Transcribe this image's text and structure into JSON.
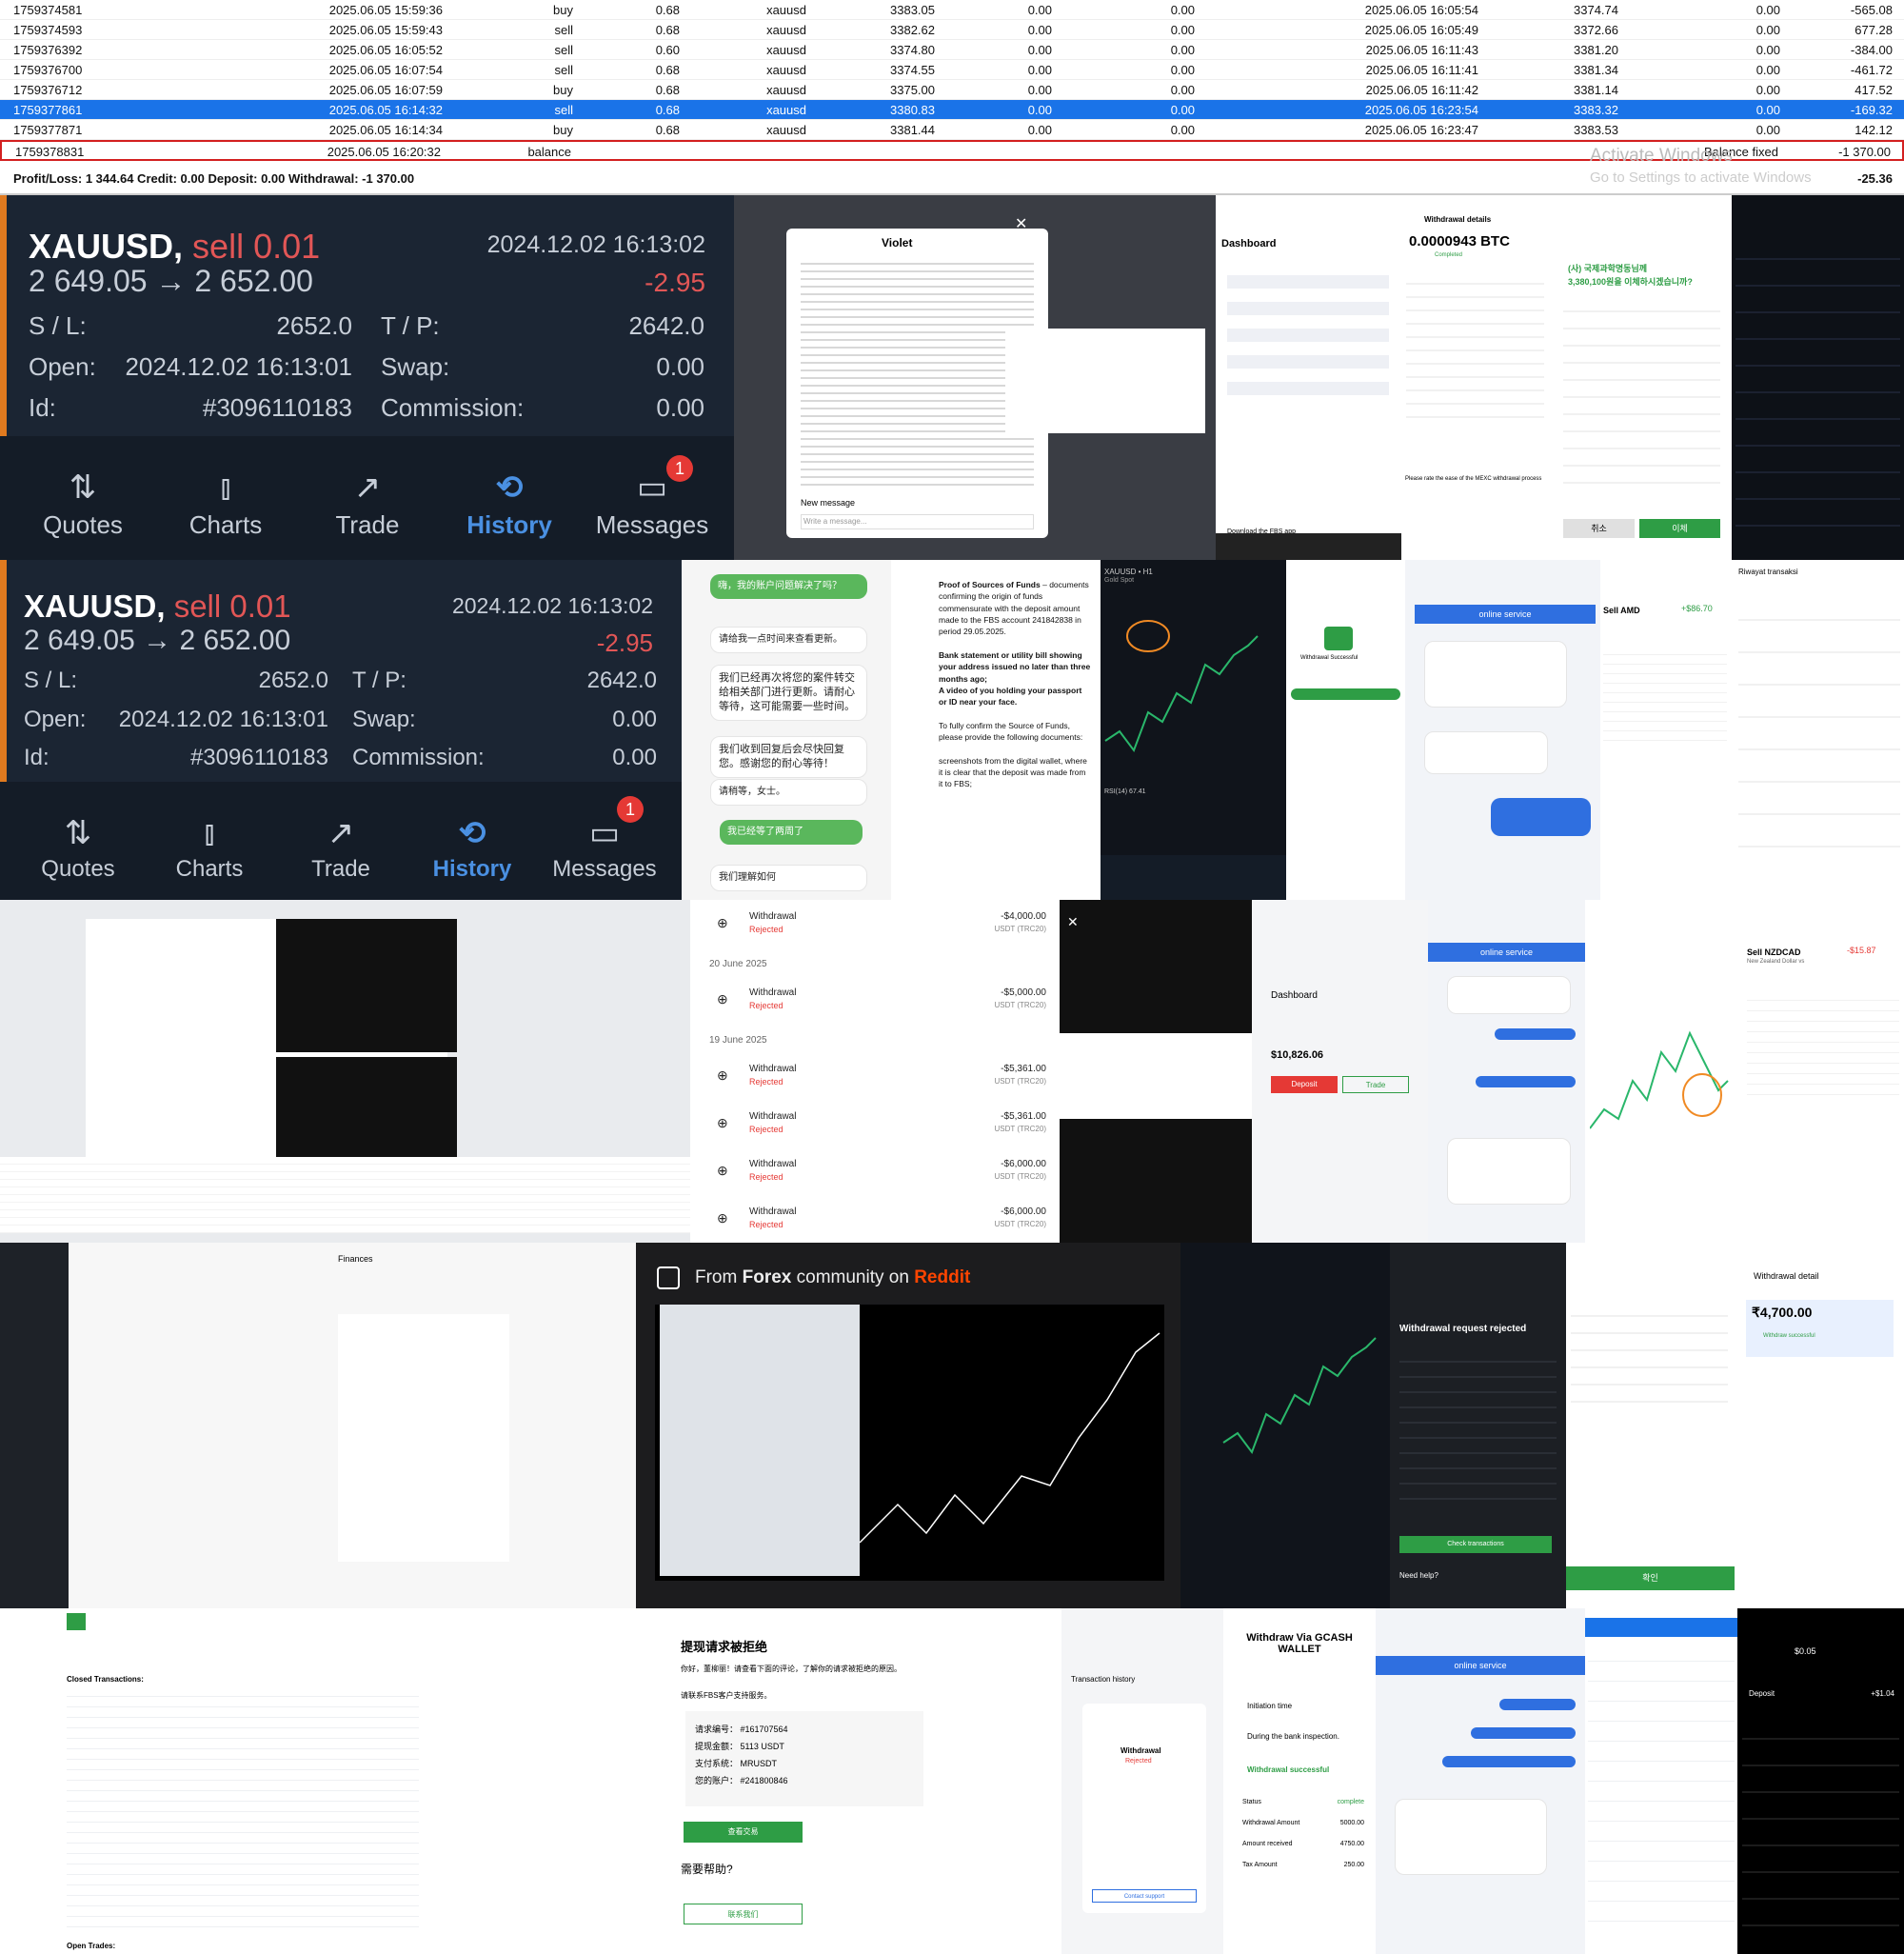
{
  "trade_table": {
    "rows": [
      {
        "id": "1759374581",
        "open_time": "2025.06.05 15:59:36",
        "type": "buy",
        "volume": "0.68",
        "symbol": "xauusd",
        "open_price": "3383.05",
        "sl": "0.00",
        "tp": "0.00",
        "close_time": "2025.06.05 16:05:54",
        "close_price": "3374.74",
        "swap": "0.00",
        "profit": "-565.08"
      },
      {
        "id": "1759374593",
        "open_time": "2025.06.05 15:59:43",
        "type": "sell",
        "volume": "0.68",
        "symbol": "xauusd",
        "open_price": "3382.62",
        "sl": "0.00",
        "tp": "0.00",
        "close_time": "2025.06.05 16:05:49",
        "close_price": "3372.66",
        "swap": "0.00",
        "profit": "677.28"
      },
      {
        "id": "1759376392",
        "open_time": "2025.06.05 16:05:52",
        "type": "sell",
        "volume": "0.60",
        "symbol": "xauusd",
        "open_price": "3374.80",
        "sl": "0.00",
        "tp": "0.00",
        "close_time": "2025.06.05 16:11:43",
        "close_price": "3381.20",
        "swap": "0.00",
        "profit": "-384.00"
      },
      {
        "id": "1759376700",
        "open_time": "2025.06.05 16:07:54",
        "type": "sell",
        "volume": "0.68",
        "symbol": "xauusd",
        "open_price": "3374.55",
        "sl": "0.00",
        "tp": "0.00",
        "close_time": "2025.06.05 16:11:41",
        "close_price": "3381.34",
        "swap": "0.00",
        "profit": "-461.72"
      },
      {
        "id": "1759376712",
        "open_time": "2025.06.05 16:07:59",
        "type": "buy",
        "volume": "0.68",
        "symbol": "xauusd",
        "open_price": "3375.00",
        "sl": "0.00",
        "tp": "0.00",
        "close_time": "2025.06.05 16:11:42",
        "close_price": "3381.14",
        "swap": "0.00",
        "profit": "417.52"
      },
      {
        "id": "1759377861",
        "open_time": "2025.06.05 16:14:32",
        "type": "sell",
        "volume": "0.68",
        "symbol": "xauusd",
        "open_price": "3380.83",
        "sl": "0.00",
        "tp": "0.00",
        "close_time": "2025.06.05 16:23:54",
        "close_price": "3383.32",
        "swap": "0.00",
        "profit": "-169.32"
      },
      {
        "id": "1759377871",
        "open_time": "2025.06.05 16:14:34",
        "type": "buy",
        "volume": "0.68",
        "symbol": "xauusd",
        "open_price": "3381.44",
        "sl": "0.00",
        "tp": "0.00",
        "close_time": "2025.06.05 16:23:47",
        "close_price": "3383.53",
        "swap": "0.00",
        "profit": "142.12"
      }
    ],
    "balance_row": {
      "id": "1759378831",
      "time": "2025.06.05 16:20:32",
      "type": "balance",
      "comment": "Balance fixed",
      "profit": "-1 370.00"
    },
    "summary": "Profit/Loss: 1 344.64  Credit: 0.00  Deposit: 0.00  Withdrawal: -1 370.00",
    "summary_total": "-25.36",
    "watermark_1": "Activate Windows",
    "watermark_2": "Go to Settings to activate Windows"
  },
  "trade_card_1": {
    "symbol": "XAUUSD,",
    "side": "sell 0.01",
    "datetime": "2024.12.02 16:13:02",
    "price_move": "2 649.05 → 2 652.00",
    "profit": "-2.95",
    "sl_label": "S / L:",
    "sl_value": "2652.0",
    "tp_label": "T / P:",
    "tp_value": "2642.0",
    "open_label": "Open:",
    "open_value": "2024.12.02 16:13:01",
    "swap_label": "Swap:",
    "swap_value": "0.00",
    "id_label": "Id:",
    "id_value": "#3096110183",
    "commission_label": "Commission:",
    "commission_value": "0.00"
  },
  "trade_card_2": {
    "symbol": "XAUUSD,",
    "side": "sell 0.01",
    "datetime": "2024.12.02 16:13:02",
    "price_move": "2 649.05 → 2 652.00",
    "profit": "-2.95",
    "sl_label": "S / L:",
    "sl_value": "2652.0",
    "tp_label": "T / P:",
    "tp_value": "2642.0",
    "open_label": "Open:",
    "open_value": "2024.12.02 16:13:01",
    "swap_label": "Swap:",
    "swap_value": "0.00",
    "id_label": "Id:",
    "id_value": "#3096110183",
    "commission_label": "Commission:",
    "commission_value": "0.00"
  },
  "bottom_nav": {
    "quotes": "Quotes",
    "charts": "Charts",
    "trade": "Trade",
    "history": "History",
    "messages": "Messages",
    "badge": "1"
  },
  "tiles": {
    "violet_chat_name": "Violet",
    "new_message": "New message",
    "write_message": "Write a message...",
    "fbs_dashboard": "Dashboard",
    "fbs_download": "Download the FBS app",
    "btc_title": "Withdrawal details",
    "btc_amount": "0.0000943 BTC",
    "btc_status": "Completed",
    "btc_rate_prompt": "Please rate the ease of the MEXC withdrawal process",
    "korean_header": "(사) 국제과학명동님께",
    "korean_amount": "3,380,100원을 이체하시겠습니까?",
    "korean_btn_cancel": "취소",
    "korean_btn_ok": "이체",
    "chat_cn_1": "嗨，我的账户问题解决了吗？",
    "chat_cn_2": "请给我一点时间来查看更新。",
    "chat_cn_3": "我们已经再次将您的案件转交给相关部门进行更新。请耐心等待，这可能需要一些时间。",
    "chat_cn_4": "我们收到回复后会尽快回复您。感谢您的耐心等待！",
    "chat_cn_5": "请稍等，女士。",
    "chat_cn_6": "我已经等了两周了",
    "chat_cn_7": "我们理解如何",
    "proof_title": "Proof of Sources of Funds",
    "proof_text": "documents confirming the origin of funds commensurate with the deposit amount made to the FBS account 241842838 in period 29.05.2025.",
    "proof_bank": "Bank statement or utility bill showing your address issued no later than three months ago;",
    "proof_video": "A video of you holding your passport or ID near your face.",
    "proof_confirm": "To fully confirm the Source of Funds, please provide the following documents:",
    "proof_screens": "screenshots from the digital wallet, where it is clear that the deposit was made from it to FBS;",
    "chart_symbol": "XAUUSD • H1",
    "chart_sub": "Gold Spot",
    "chart_rsi": "RSI(14) 67.41",
    "withdraw_success": "Withdrawal Successful",
    "online_service": "online service",
    "sell_amd": "Sell AMD",
    "sell_amd_pl": "+$86.70",
    "riwayat": "Riwayat transaksi",
    "withdrawals": [
      {
        "label": "Withdrawal",
        "status": "Rejected",
        "amount": "-$4,000.00",
        "method": "USDT (TRC20)"
      },
      {
        "label": "Withdrawal",
        "status": "Rejected",
        "amount": "-$5,000.00",
        "method": "USDT (TRC20)"
      },
      {
        "label": "Withdrawal",
        "status": "Rejected",
        "amount": "-$5,361.00",
        "method": "USDT (TRC20)"
      },
      {
        "label": "Withdrawal",
        "status": "Rejected",
        "amount": "-$5,361.00",
        "method": "USDT (TRC20)"
      },
      {
        "label": "Withdrawal",
        "status": "Rejected",
        "amount": "-$6,000.00",
        "method": "USDT (TRC20)"
      },
      {
        "label": "Withdrawal",
        "status": "Rejected",
        "amount": "-$6,000.00",
        "method": "USDT (TRC20)"
      }
    ],
    "wd_date_1": "20 June 2025",
    "wd_date_2": "19 June 2025",
    "dash2_title": "Dashboard",
    "dash2_balance": "$10,826.06",
    "dash2_deposit": "Deposit",
    "dash2_trade": "Trade",
    "sell_nzd": "Sell NZDCAD",
    "sell_nzd_pl": "-$15.87",
    "sell_nzd_sub": "New Zealand Dollar vs",
    "finances": "Finances",
    "reddit_banner_pre": "From",
    "reddit_banner_mid": "Forex",
    "reddit_banner_post": "community on",
    "reddit_name": "Reddit",
    "wd_rejected_title": "Withdrawal request rejected",
    "wd_rejected_btn": "Check transactions",
    "need_help": "Need help?",
    "inr_title": "Withdrawal detail",
    "inr_amount": "₹4,700.00",
    "inr_status": "Withdraw successful",
    "korean_confirm": "확인",
    "closed_transactions": "Closed Transactions:",
    "open_trades": "Open Trades:",
    "cn_reject_title": "提现请求被拒绝",
    "cn_reject_body": "你好，董柳丽！请查看下面的评论，了解你的请求被拒绝的原因。",
    "cn_reject_line": "请联系FBS客户支持服务。",
    "cn_req_no": "请求编号： #161707564",
    "cn_amount": "提现金额： 5113 USDT",
    "cn_pay": "支付系统： MRUSDT",
    "cn_account": "您的账户： #241800846",
    "cn_check_btn": "查看交易",
    "cn_need_help": "需要帮助?",
    "cn_contact_btn": "联系我们",
    "gcash_title": "Withdraw Via GCASH WALLET",
    "gcash_init": "Initiation time",
    "gcash_inspect": "During the bank inspection.",
    "gcash_done": "Withdrawal successful",
    "gcash_status": "Status",
    "gcash_status_val": "complete",
    "gcash_amount_label": "Withdrawal Amount",
    "gcash_amount_val": "5000.00",
    "gcash_received_label": "Amount received",
    "gcash_received_val": "4750.00",
    "gcash_tax_label": "Tax Amount",
    "gcash_tax_val": "250.00",
    "tx_history": "Transaction history",
    "tx_withdrawal": "Withdrawal",
    "tx_rejected": "Rejected",
    "tx_contact": "Contact support",
    "dark_deposit": "Deposit",
    "dark_amount": "+$1.04"
  }
}
